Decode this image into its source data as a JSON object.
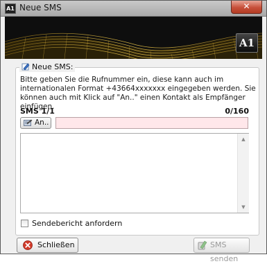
{
  "window": {
    "app_icon": "A1",
    "title": "Neue SMS",
    "close_icon": "close-icon",
    "close_glyph": "✕"
  },
  "banner": {
    "logo": "A1"
  },
  "form": {
    "group_title": "Neue SMS:",
    "group_icon": "pen-icon",
    "description": "Bitte geben Sie die Rufnummer ein, diese kann auch im internationalen Format +43664xxxxxxx eingegeben werden. Sie können auch mit Klick auf \"An..\" einen Kontakt als Empfänger einfügen.",
    "sms_count": "SMS 1/1",
    "char_count": "0/160",
    "an_button_label": "An..",
    "an_button_icon": "address-book-icon",
    "recipient_value": "",
    "message_value": "",
    "report_checkbox_label": "Sendebericht anfordern",
    "report_checked": false
  },
  "footer": {
    "close_label": "Schließen",
    "close_icon": "cancel-icon",
    "send_label": "SMS senden",
    "send_icon": "send-sms-icon",
    "send_enabled": false
  },
  "colors": {
    "recipient_bg": "#ffe7ea",
    "close_red": "#c7503a",
    "banner_gold": "#c9a227"
  }
}
